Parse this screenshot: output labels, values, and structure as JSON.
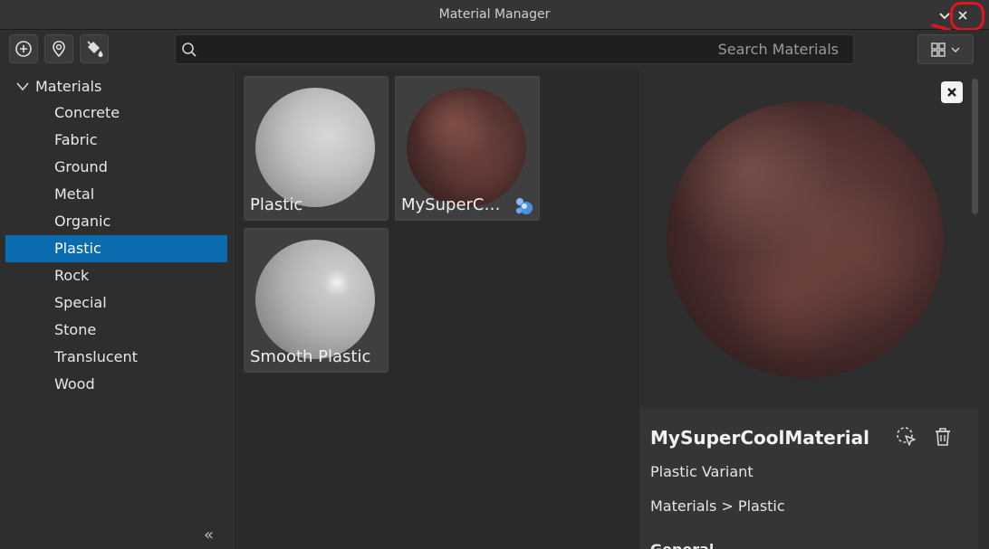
{
  "window": {
    "title": "Material Manager"
  },
  "toolbar": {
    "search_placeholder": "Search Materials",
    "search_value": ""
  },
  "sidebar": {
    "root_label": "Materials",
    "items": [
      {
        "label": "Concrete"
      },
      {
        "label": "Fabric"
      },
      {
        "label": "Ground"
      },
      {
        "label": "Metal"
      },
      {
        "label": "Organic"
      },
      {
        "label": "Plastic",
        "selected": true
      },
      {
        "label": "Rock"
      },
      {
        "label": "Special"
      },
      {
        "label": "Stone"
      },
      {
        "label": "Translucent"
      },
      {
        "label": "Wood"
      }
    ],
    "collapse_glyph": "«"
  },
  "grid": {
    "tiles": [
      {
        "label": "Plastic"
      },
      {
        "label": "MySuperCo…",
        "is_variant": true
      },
      {
        "label": "Smooth Plastic"
      }
    ]
  },
  "details": {
    "name": "MySuperCoolMaterial",
    "variant_text": "Plastic Variant",
    "path": "Materials > Plastic",
    "cut_off_heading": "General"
  },
  "colors": {
    "selection": "#0a6cae",
    "annotation": "#e8121d"
  }
}
